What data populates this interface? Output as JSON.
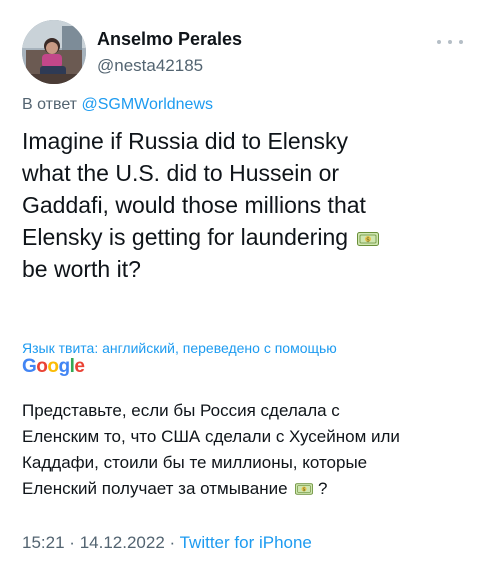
{
  "author": {
    "display_name": "Anselmo Perales",
    "handle": "@nesta42185",
    "avatar_icon": "profile-photo"
  },
  "reply": {
    "prefix": "В ответ",
    "mention": "@SGMWorldnews"
  },
  "tweet": {
    "lines": [
      "Imagine if Russia did to Elensky",
      "what the U.S. did to Hussein or",
      "Gaddafi, would those millions that",
      "Elensky is getting for laundering",
      "be worth it?"
    ],
    "emoji": "money-emoji"
  },
  "translation": {
    "label": "Язык твита: английский, переведено с помощью",
    "provider": "Google",
    "lines": [
      "Представьте, если бы Россия сделала с",
      "Еленским то, что США сделали с Хусейном или",
      "Каддафи, стоили бы те миллионы, которые",
      "Еленский получает за отмывание",
      "?"
    ]
  },
  "meta": {
    "time": "15:21",
    "separator1": "·",
    "date": "14.12.2022",
    "separator2": "·",
    "source": "Twitter for iPhone"
  },
  "colors": {
    "link": "#1d9bf0",
    "secondary_text": "#536471",
    "primary_text": "#0f1419"
  }
}
